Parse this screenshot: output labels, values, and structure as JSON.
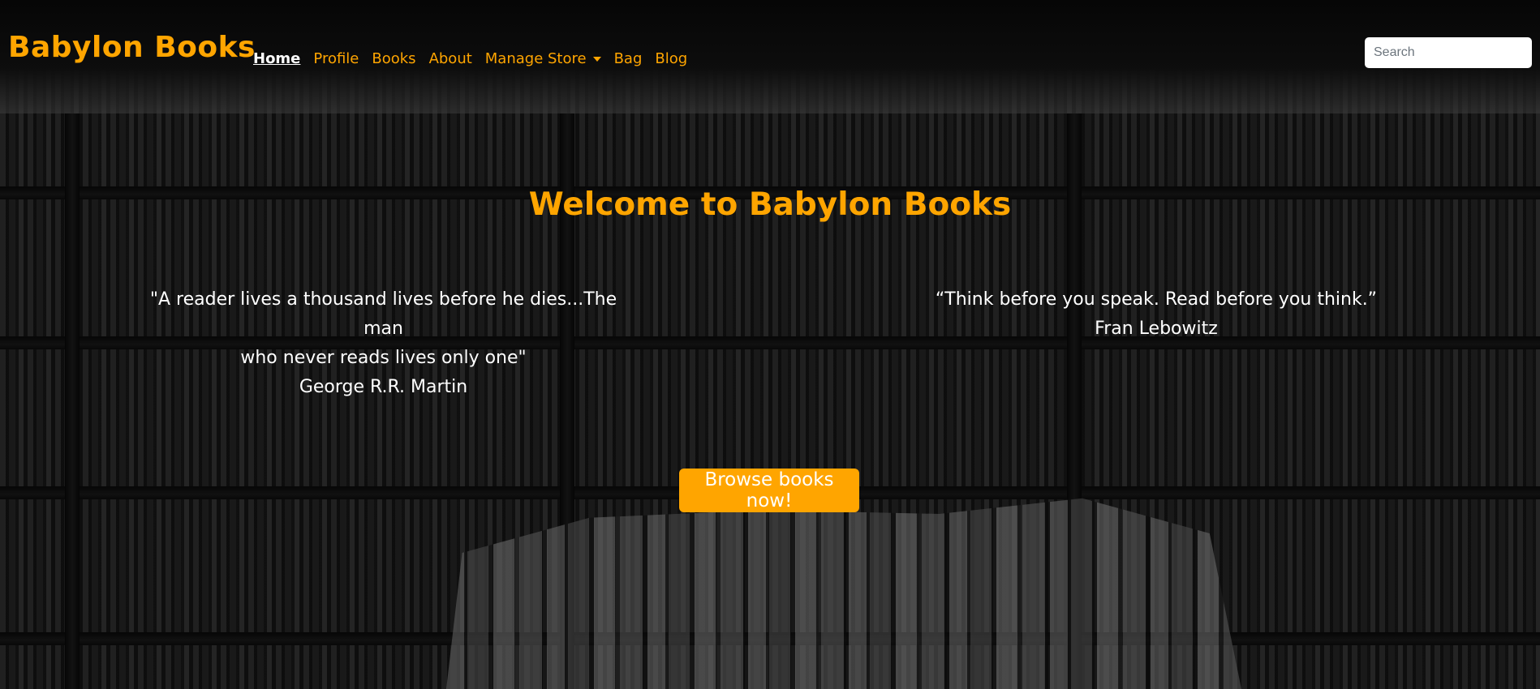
{
  "brand": {
    "name": "Babylon Books"
  },
  "nav": {
    "items": [
      {
        "label": "Home",
        "active": true
      },
      {
        "label": "Profile"
      },
      {
        "label": "Books"
      },
      {
        "label": "About"
      },
      {
        "label": "Manage Store",
        "dropdown": true
      },
      {
        "label": "Bag"
      },
      {
        "label": "Blog"
      }
    ]
  },
  "search": {
    "placeholder": "Search",
    "value": ""
  },
  "hero": {
    "title": "Welcome to Babylon Books",
    "quotes": [
      {
        "line1": "\"A reader lives a thousand lives before he dies...The man",
        "line2": "who never reads lives only one\"",
        "author": "George R.R. Martin"
      },
      {
        "line1": "“Think before you speak. Read before you think.”",
        "author": "Fran Lebowitz"
      }
    ],
    "cta_label": "Browse books now!"
  },
  "colors": {
    "accent": "#ffa500",
    "text": "#ffffff",
    "navbar_bg": "#0a0a0a"
  },
  "icons": {
    "dropdown": "caret-down-icon"
  }
}
